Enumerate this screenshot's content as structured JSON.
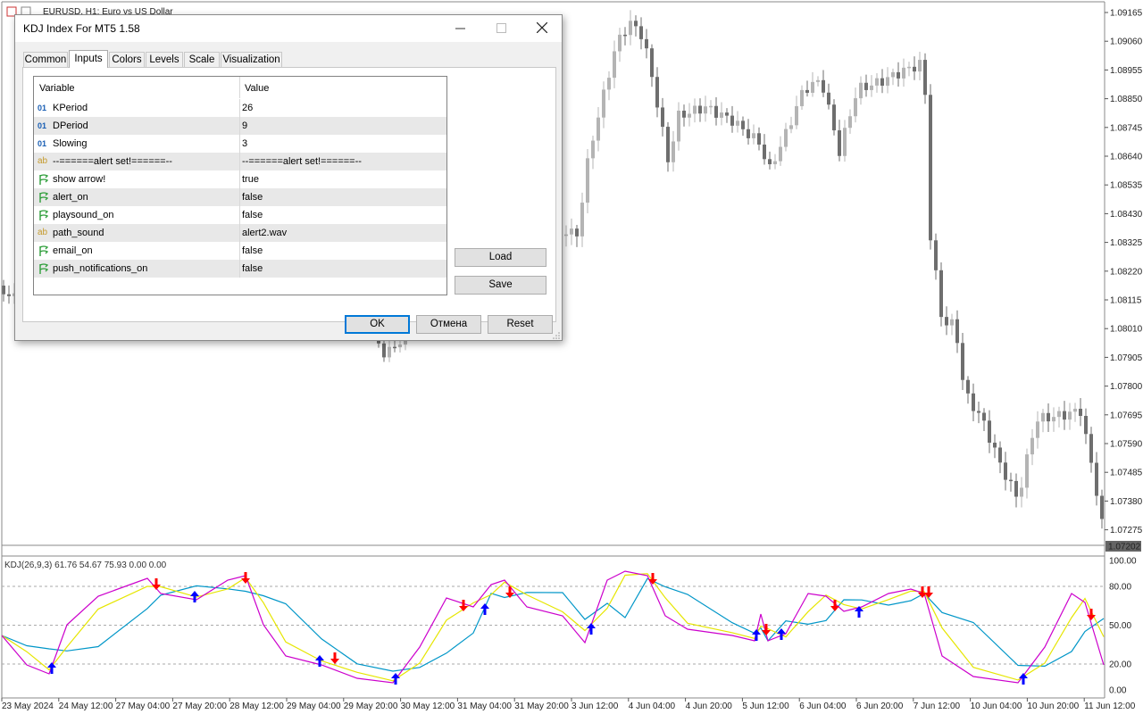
{
  "chart": {
    "window_title": "EURUSD, H1:  Euro vs US Dollar",
    "price_labels": [
      "1.09165",
      "1.09060",
      "1.08955",
      "1.08850",
      "1.08745",
      "1.08640",
      "1.08535",
      "1.08430",
      "1.08325",
      "1.08220",
      "1.08115",
      "1.08010",
      "1.07905",
      "1.07800",
      "1.07695",
      "1.07590",
      "1.07485",
      "1.07380",
      "1.07275"
    ],
    "current_price": "1.07202",
    "indicator_title": "KDJ(26,9,3) 61.76 54.67 75.93 0.00 0.00",
    "indicator_levels": [
      "100.00",
      "80.00",
      "50.00",
      "20.00",
      "0.00"
    ],
    "time_labels": [
      "23 May 2024",
      "24 May 12:00",
      "27 May 04:00",
      "27 May 20:00",
      "28 May 12:00",
      "29 May 04:00",
      "29 May 20:00",
      "30 May 12:00",
      "31 May 04:00",
      "31 May 20:00",
      "3 Jun 12:00",
      "4 Jun 04:00",
      "4 Jun 20:00",
      "5 Jun 12:00",
      "6 Jun 04:00",
      "6 Jun 20:00",
      "7 Jun 12:00",
      "10 Jun 04:00",
      "10 Jun 20:00",
      "11 Jun 12:00"
    ],
    "colors": {
      "up_candle": "#b4b4b4",
      "down_candle": "#6e6e6e",
      "k_line": "#cc00cc",
      "d_line": "#e6e600",
      "j_line": "#0096c8",
      "arrow_up": "#0000ff",
      "arrow_down": "#ff0000",
      "price_badge": "#646464"
    }
  },
  "dialog": {
    "title": "KDJ Index For MT5 1.58",
    "minimize_icon": "minimize-icon",
    "maximize_icon": "maximize-icon",
    "close_icon": "close-icon",
    "tabs": [
      "Common",
      "Inputs",
      "Colors",
      "Levels",
      "Scale",
      "Visualization"
    ],
    "active_tab": "Inputs",
    "grid": {
      "headers": [
        "Variable",
        "Value"
      ],
      "rows": [
        {
          "type": "int",
          "icon": "01",
          "variable": "KPeriod",
          "value": "26"
        },
        {
          "type": "int",
          "icon": "01",
          "variable": "DPeriod",
          "value": "9"
        },
        {
          "type": "int",
          "icon": "01",
          "variable": "Slowing",
          "value": "3"
        },
        {
          "type": "str",
          "icon": "ab",
          "variable": "--======alert set!======--",
          "value": "--======alert set!======--"
        },
        {
          "type": "bool",
          "icon": "bool-icon",
          "variable": "show arrow!",
          "value": "true"
        },
        {
          "type": "bool",
          "icon": "bool-icon",
          "variable": "alert_on",
          "value": "false"
        },
        {
          "type": "bool",
          "icon": "bool-icon",
          "variable": "playsound_on",
          "value": "false"
        },
        {
          "type": "str",
          "icon": "ab",
          "variable": "path_sound",
          "value": "alert2.wav"
        },
        {
          "type": "bool",
          "icon": "bool-icon",
          "variable": "email_on",
          "value": "false"
        },
        {
          "type": "bool",
          "icon": "bool-icon",
          "variable": "push_notifications_on",
          "value": "false"
        }
      ]
    },
    "load_label": "Load",
    "save_label": "Save",
    "ok_label": "OK",
    "cancel_label": "Отмена",
    "reset_label": "Reset"
  }
}
